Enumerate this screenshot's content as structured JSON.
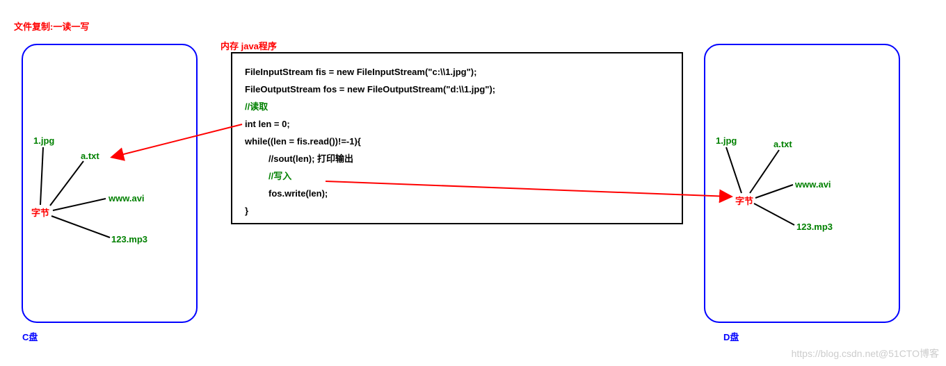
{
  "title": "文件复制:一读一写",
  "memory_label": "内存  java程序",
  "disk_left": {
    "label": "C盘"
  },
  "disk_right": {
    "label": "D盘"
  },
  "byte_label": "字节",
  "files": {
    "f1": "1.jpg",
    "f2": "a.txt",
    "f3": "www.avi",
    "f4": "123.mp3"
  },
  "code": {
    "l1": "FileInputStream fis = new FileInputStream(\"c:\\\\1.jpg\");",
    "l2": "FileOutputStream fos = new FileOutputStream(\"d:\\\\1.jpg\");",
    "l3": "//读取",
    "l4": "int len = 0;",
    "l5": "while((len = fis.read())!=-1){",
    "l6": "//sout(len); 打印输出",
    "l7": "//写入",
    "l8": "fos.write(len);",
    "l9": "}"
  },
  "watermark": "https://blog.csdn.net@51CTO博客"
}
